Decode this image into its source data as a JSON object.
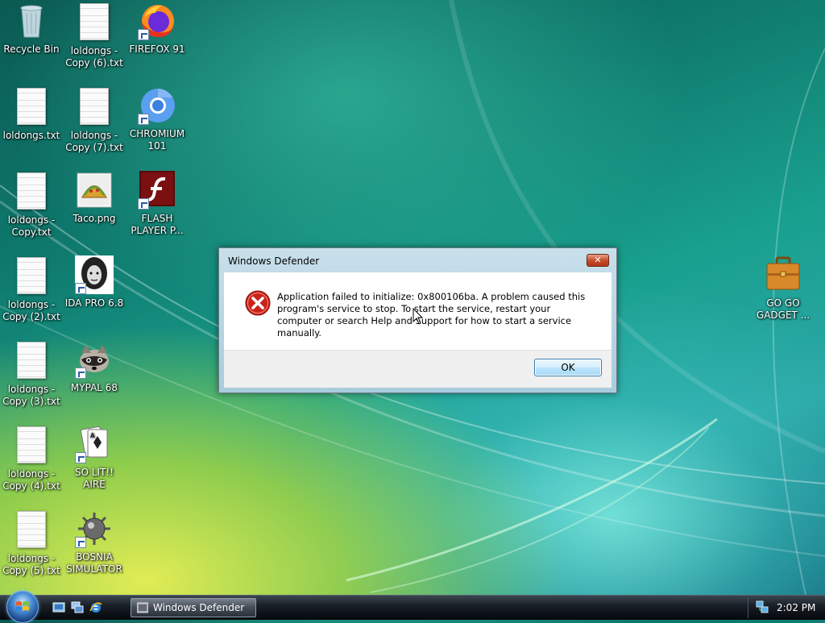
{
  "desktop": {
    "icons": [
      {
        "label": "Recycle Bin"
      },
      {
        "label": "loldongs - Copy (6).txt"
      },
      {
        "label": "FIREFOX 91"
      },
      {
        "label": "loldongs.txt"
      },
      {
        "label": "loldongs - Copy (7).txt"
      },
      {
        "label": "CHROMIUM 101"
      },
      {
        "label": "loldongs - Copy.txt"
      },
      {
        "label": "Taco.png"
      },
      {
        "label": "FLASH PLAYER P..."
      },
      {
        "label": "loldongs - Copy (2).txt"
      },
      {
        "label": "IDA PRO 6.8"
      },
      {
        "label": "loldongs - Copy (3).txt"
      },
      {
        "label": "MYPAL 68"
      },
      {
        "label": "loldongs - Copy (4).txt"
      },
      {
        "label": "SO LIT!! AIRE"
      },
      {
        "label": "loldongs - Copy (5).txt"
      },
      {
        "label": "BOSNIA SIMULATOR"
      },
      {
        "label": "GO GO GADGET ..."
      }
    ]
  },
  "dialog": {
    "title": "Windows Defender",
    "close_label": "✕",
    "icon": "error-icon",
    "message": "Application failed to initialize: 0x800106ba. A problem caused this program's service to stop. To start the service, restart your computer or search Help and Support for how to start a service manually.",
    "ok_label": "OK"
  },
  "taskbar": {
    "quick_launch": [
      "show-desktop-icon",
      "switch-windows-icon",
      "internet-explorer-icon"
    ],
    "task_button_label": "Windows Defender",
    "clock": "2:02 PM"
  }
}
